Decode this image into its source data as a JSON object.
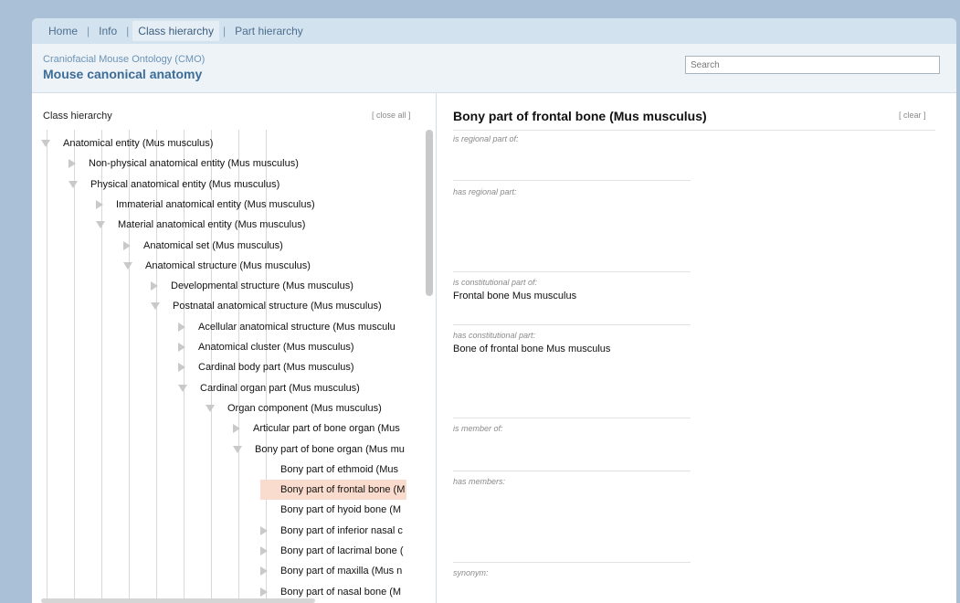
{
  "tabs": [
    {
      "label": "Home"
    },
    {
      "label": "Info"
    },
    {
      "label": "Class hierarchy"
    },
    {
      "label": "Part hierarchy"
    }
  ],
  "tab_separator": "|",
  "header": {
    "subtitle": "Craniofacial Mouse Ontology (CMO)",
    "title": "Mouse canonical anatomy",
    "search_placeholder": "Search"
  },
  "left_panel": {
    "heading": "Class hierarchy",
    "close_all": "[ close all ]"
  },
  "tree": [
    {
      "label": "Anatomical entity (Mus musculus)",
      "state": "expanded"
    },
    {
      "label": "Non-physical anatomical entity (Mus musculus)",
      "state": "collapsed"
    },
    {
      "label": "Physical anatomical entity (Mus musculus)",
      "state": "expanded"
    },
    {
      "label": "Immaterial anatomical entity (Mus musculus)",
      "state": "collapsed"
    },
    {
      "label": "Material anatomical entity (Mus musculus)",
      "state": "expanded"
    },
    {
      "label": "Anatomical set (Mus musculus)",
      "state": "collapsed"
    },
    {
      "label": "Anatomical structure (Mus musculus)",
      "state": "expanded"
    },
    {
      "label": "Developmental structure (Mus musculus)",
      "state": "collapsed"
    },
    {
      "label": "Postnatal anatomical structure (Mus musculus)",
      "state": "expanded"
    },
    {
      "label": "Acellular anatomical structure (Mus musculu",
      "state": "collapsed"
    },
    {
      "label": "Anatomical cluster (Mus musculus)",
      "state": "collapsed"
    },
    {
      "label": "Cardinal body part (Mus musculus)",
      "state": "collapsed"
    },
    {
      "label": "Cardinal organ part (Mus musculus)",
      "state": "expanded"
    },
    {
      "label": "Organ component (Mus musculus)",
      "state": "expanded"
    },
    {
      "label": "Articular part of bone organ (Mus",
      "state": "collapsed"
    },
    {
      "label": "Bony part of bone organ (Mus mu",
      "state": "expanded"
    },
    {
      "label": "Bony part of ethmoid (Mus",
      "state": "leaf"
    },
    {
      "label": "Bony part of frontal bone (M",
      "state": "leaf",
      "selected": true
    },
    {
      "label": "Bony part of hyoid bone (M",
      "state": "leaf"
    },
    {
      "label": "Bony part of inferior nasal c",
      "state": "collapsed"
    },
    {
      "label": "Bony part of lacrimal bone (",
      "state": "collapsed"
    },
    {
      "label": "Bony part of maxilla (Mus n",
      "state": "collapsed"
    },
    {
      "label": "Bony part of nasal bone (M",
      "state": "collapsed"
    }
  ],
  "detail": {
    "title": "Bony part of frontal bone (Mus musculus)",
    "clear": "[ clear ]",
    "properties": [
      {
        "label": "is regional part of:",
        "value": ""
      },
      {
        "label": "has regional part:",
        "value": ""
      },
      {
        "label": "is constitutional part of:",
        "value": "Frontal bone Mus musculus"
      },
      {
        "label": "has constitutional part:",
        "value": "Bone of frontal bone Mus musculus"
      },
      {
        "label": "is member of:",
        "value": ""
      },
      {
        "label": "has members:",
        "value": ""
      },
      {
        "label": "synonym:",
        "value": ""
      }
    ]
  },
  "colors": {
    "background": "#a9c0d6",
    "tab_bar": "#d2e2ee",
    "title": "#3d6c98",
    "selected_row": "#f9dccd"
  }
}
